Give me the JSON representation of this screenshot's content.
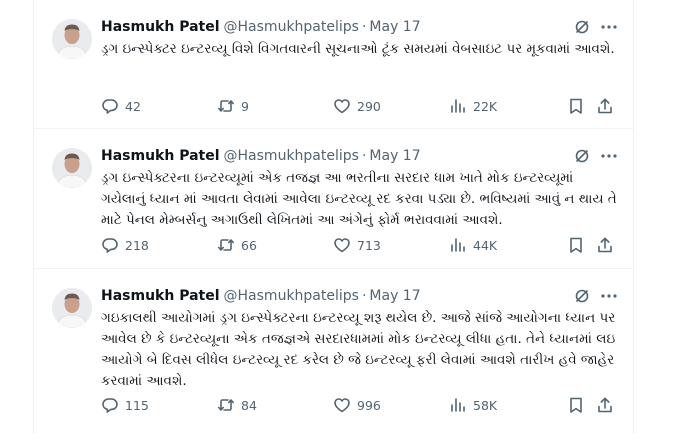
{
  "tweets": [
    {
      "name": "Hasmukh Patel",
      "handle": "@Hasmukhpatelips",
      "separator": "·",
      "date": "May 17",
      "text": "ડ્રગ ઇન્સ્પેક્ટર ઇન્ટરવ્યૂ વિશે વિગતવારની સૂચનાઓ ટૂંક સમયમાં વેબસાઇટ પર મૂકવામાં આવશે.",
      "replies": "42",
      "reposts": "9",
      "likes": "290",
      "views": "22K"
    },
    {
      "name": "Hasmukh Patel",
      "handle": "@Hasmukhpatelips",
      "separator": "·",
      "date": "May 17",
      "text": "ડ્રગ ઇન્સ્પેક્ટરના ઇન્ટરવ્યૂમાં એક તજજ્ઞ આ ભરતીના સરદાર ધામ ખાતે મોક ઇન્ટરવ્યૂમાં ગયેલાનું ધ્યાન માં આવતા લેવામાં આવેલા ઇન્ટરવ્યૂ રદ કરવા પડ્યા છે. ભવિષ્યમાં આવું ન થાય તે માટે પેનલ મેમ્બર્સનુ અગાઉથી લેખિતમાં આ અંગેનું ફોર્મ ભરાવવામાં આવશે.",
      "replies": "218",
      "reposts": "66",
      "likes": "713",
      "views": "44K"
    },
    {
      "name": "Hasmukh Patel",
      "handle": "@Hasmukhpatelips",
      "separator": "·",
      "date": "May 17",
      "text": "ગઇકાલથી આયોગમાં ડ્રગ ઇન્સ્પેક્ટરના ઇન્ટરવ્યૂ શરૂ થયેલ છે. આજે સાંજે આયોગના ધ્યાન પર આવેલ છે કે ઇન્ટરવ્યૂના એક તજજ્ઞએ સરદારધામમાં મોક ઇન્ટરવ્યૂ લીધા હતા. તેને ધ્યાનમાં લઇ આયોગે બે દિવસ લીધેલ ઇન્ટરવ્યૂ રદ કરેલ છે જે ઇન્ટરવ્યૂ ફરી લેવામાં આવશે તારીખ હવે જાહેર કરવામાં આવશે.",
      "replies": "115",
      "reposts": "84",
      "likes": "996",
      "views": "58K"
    }
  ],
  "icons": {
    "reply": "reply-icon",
    "repost": "repost-icon",
    "like": "heart-icon",
    "views": "views-icon",
    "bookmark": "bookmark-icon",
    "share": "share-icon",
    "grok": "grok-icon",
    "more": "more-icon"
  },
  "colors": {
    "text": "#0f1419",
    "secondary": "#536471",
    "border": "#eff3f4",
    "background": "#ffffff"
  }
}
